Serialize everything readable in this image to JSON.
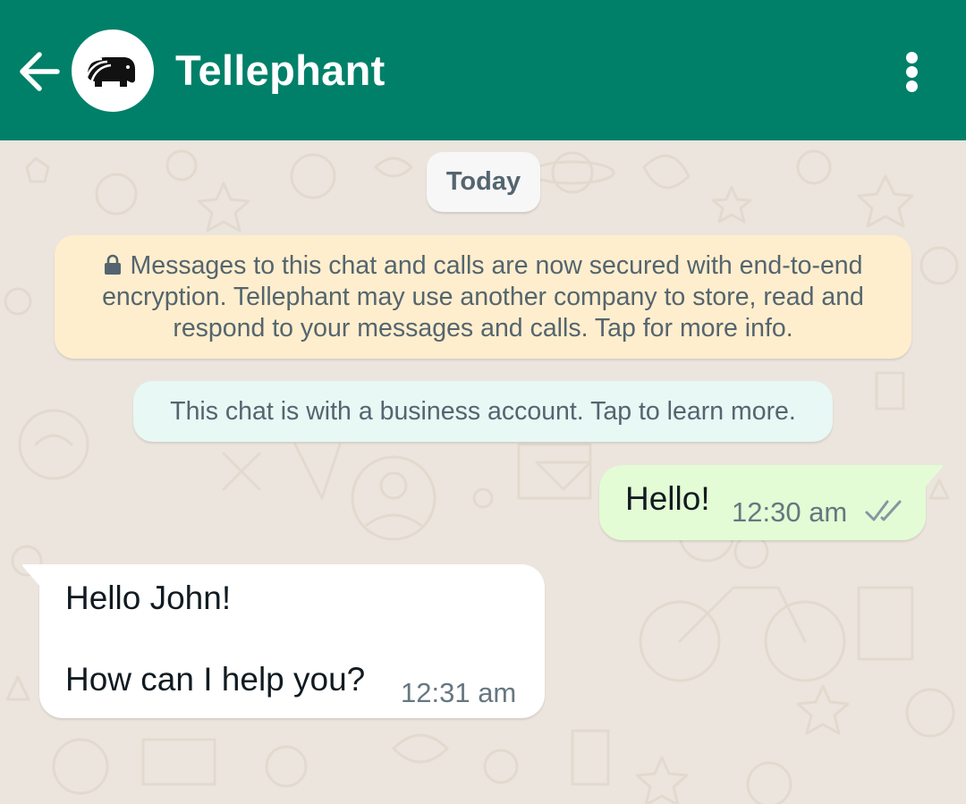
{
  "header": {
    "contact_name": "Tellephant",
    "background_color": "#008069",
    "back_icon": "arrow-left-icon",
    "avatar_icon": "elephant-logo-icon",
    "menu_icon": "more-vertical-icon"
  },
  "chat": {
    "date_label": "Today",
    "encryption_notice": {
      "icon": "lock-icon",
      "line1": "Messages to this chat and calls are now secured with end-to-end",
      "line2": "encryption. Tellephant may use another company to store, read and",
      "line3": "respond to your messages and calls. Tap for more info."
    },
    "business_notice": "This chat is with a business account. Tap to learn more.",
    "messages": [
      {
        "direction": "outgoing",
        "text": "Hello!",
        "time": "12:30 am",
        "status_icon": "double-check-icon"
      },
      {
        "direction": "incoming",
        "lines": [
          "Hello John!",
          "How can I help you?"
        ],
        "time": "12:31 am"
      }
    ]
  },
  "colors": {
    "wallpaper": "#ece5dd",
    "outgoing_bubble": "#e3fcd5",
    "incoming_bubble": "#ffffff",
    "encryption_notice_bg": "#ffeecd",
    "business_notice_bg": "#e7f8f5"
  }
}
